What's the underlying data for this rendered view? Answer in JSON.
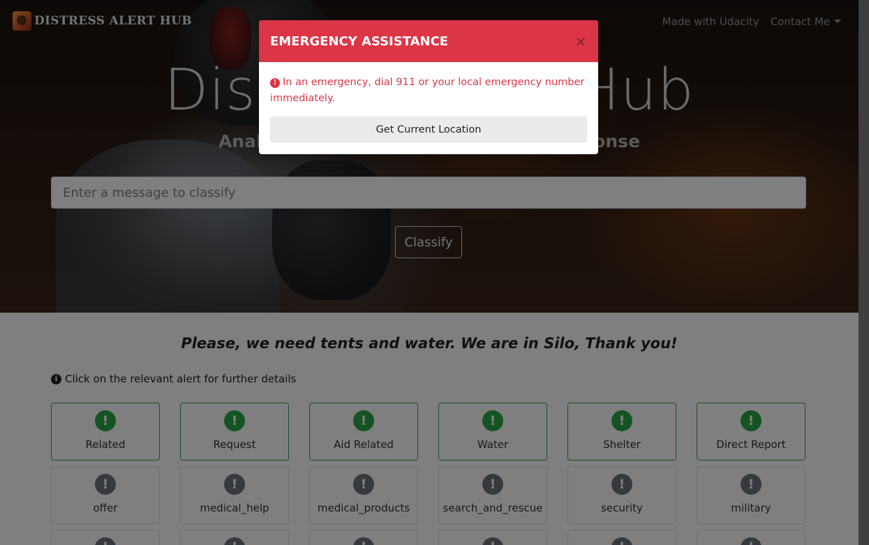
{
  "brand": {
    "name": "DISTRESS ALERT HUB"
  },
  "nav": {
    "made_with": "Made with Udacity",
    "contact": "Contact Me"
  },
  "hero": {
    "title": "Distress Alert Hub",
    "subtitle": "Analyzing Messages for Disaster Response",
    "input_placeholder": "Enter a message to classify",
    "classify_label": "Classify"
  },
  "result": {
    "message": "Please, we need tents and water. We are in Silo, Thank you!",
    "hint": "Click on the relevant alert for further details",
    "rows": [
      [
        {
          "label": "Related",
          "active": true
        },
        {
          "label": "Request",
          "active": true
        },
        {
          "label": "Aid Related",
          "active": true
        },
        {
          "label": "Water",
          "active": true
        },
        {
          "label": "Shelter",
          "active": true
        },
        {
          "label": "Direct Report",
          "active": true
        }
      ],
      [
        {
          "label": "offer",
          "active": false
        },
        {
          "label": "medical_help",
          "active": false
        },
        {
          "label": "medical_products",
          "active": false
        },
        {
          "label": "search_and_rescue",
          "active": false
        },
        {
          "label": "security",
          "active": false
        },
        {
          "label": "military",
          "active": false
        }
      ]
    ]
  },
  "modal": {
    "title": "EMERGENCY ASSISTANCE",
    "close_symbol": "×",
    "message": "In an emergency, dial 911 or your local emergency number immediately.",
    "button_label": "Get Current Location"
  },
  "colors": {
    "danger": "#dc3545",
    "success": "#28a745",
    "inactive": "#6c757d"
  },
  "icons": {
    "alert": "exclamation-circle-icon",
    "info": "info-circle-icon",
    "close": "close-icon"
  }
}
